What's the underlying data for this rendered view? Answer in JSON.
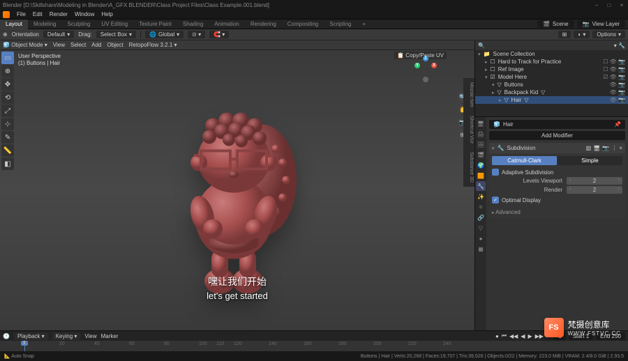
{
  "titlebar": "Blender [D:\\Skillshare\\Modeling in Blender\\A_GFX BLENDER\\Class Project Files\\Class Example.001.blend]",
  "menubar": [
    "File",
    "Edit",
    "Render",
    "Window",
    "Help"
  ],
  "workspaces": [
    "Layout",
    "Modeling",
    "Sculpting",
    "UV Editing",
    "Texture Paint",
    "Shading",
    "Animation",
    "Rendering",
    "Compositing",
    "Scripting",
    "+"
  ],
  "scene_label": "Scene",
  "viewlayer_label": "View Layer",
  "toolbar": {
    "orientation_lbl": "Orientation",
    "orientation_val": "Default",
    "drag_lbl": "Drag:",
    "drag_val": "Select Box",
    "pivot_val": "Global",
    "options": "Options"
  },
  "vp_header": {
    "mode": "Object Mode",
    "menus": [
      "View",
      "Select",
      "Add",
      "Object"
    ],
    "retopoflow": "RetopoFlow 3.2.1"
  },
  "viewinfo": {
    "persp": "User Perspective",
    "obj": "(1) Buttons | Hair"
  },
  "copypaste": "Copy/Paste UV",
  "subtitle_cn": "嘿让我们开始",
  "subtitle_en": "let's get started",
  "outliner": {
    "header": "Scene Collection",
    "rows": [
      {
        "name": "Hard to Track for Practice",
        "indent": 1
      },
      {
        "name": "Ref Image",
        "indent": 1
      },
      {
        "name": "Model Here",
        "indent": 1
      },
      {
        "name": "Buttons",
        "indent": 2
      },
      {
        "name": "Backpack Kid",
        "indent": 2
      },
      {
        "name": "Hair",
        "indent": 3,
        "sel": true
      }
    ]
  },
  "properties": {
    "obj_name": "Hair",
    "add_modifier": "Add Modifier",
    "modifier": "Subdivision",
    "catmull": "Catmull-Clark",
    "simple": "Simple",
    "adaptive": "Adaptive Subdivision",
    "levels_lbl": "Levels Viewport",
    "levels_val": "2",
    "render_lbl": "Render",
    "render_val": "2",
    "optimal": "Optimal Display",
    "advanced": "Advanced"
  },
  "timeline": {
    "menus": [
      "Playback",
      "Keying",
      "View",
      "Marker"
    ],
    "ticks": [
      "0",
      "20",
      "40",
      "60",
      "80",
      "100",
      "110",
      "120",
      "140",
      "160",
      "180",
      "200",
      "220",
      "240"
    ],
    "cursor": "1",
    "start_lbl": "Start",
    "start_val": "1",
    "end_lbl": "End",
    "end_val": "250"
  },
  "statusbar": {
    "left": "Auto Snap",
    "right": "Buttons | Hair | Verts:20,268 | Faces:19,707 | Tris:39,526 | Objects:0/22 | Memory: 223.0 MiB | VRAM: 2.4/8.0 GiB | 2.93.5"
  },
  "sidetabs": [
    "Mozaic-tvm",
    "Shortcut VUr",
    "Substance 3D"
  ],
  "watermark": {
    "logo": "FS",
    "name": "梵摄创意库",
    "url": "WWW.FSTVC.CC"
  }
}
